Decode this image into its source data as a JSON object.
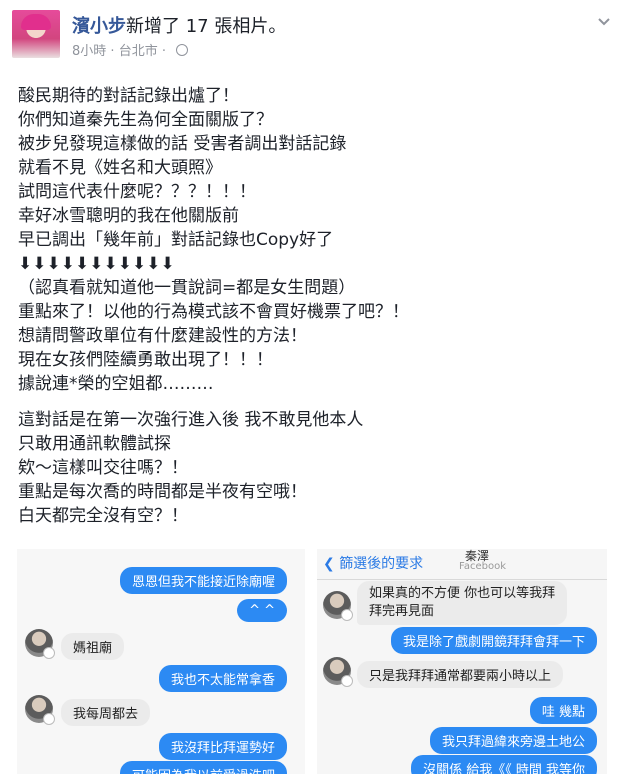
{
  "post": {
    "author": "濱小步",
    "action": "新增了 17 張相片。",
    "time": "8小時",
    "separator": "·",
    "location": "台北市",
    "separator2": "·"
  },
  "body_lines": [
    "酸民期待的對話記錄出爐了！",
    "你們知道秦先生為何全面關版了？",
    "被步兒發現這樣做的話 受害者調出對話記錄",
    "就看不見《姓名和大頭照》",
    "試問這代表什麼呢？？？！！！",
    "幸好冰雪聰明的我在他關版前",
    "早已調出「幾年前」對話記錄也Copy好了",
    "⬇⬇⬇⬇⬇⬇⬇⬇⬇⬇⬇",
    "（認真看就知道他一貫說詞=都是女生問題）",
    "重點來了！以他的行為模式該不會買好機票了吧？！",
    "想請問警政單位有什麼建設性的方法！",
    "現在女孩們陸續勇敢出現了！！！",
    "據說連*榮的空姐都………"
  ],
  "body_lines_2": [
    "這對話是在第一次強行進入後 我不敢見他本人",
    "只敢用通訊軟體試探",
    "欸～這樣叫交往嗎？！",
    "重點是每次喬的時間都是半夜有空哦！",
    "白天都完全沒有空？！"
  ],
  "photo_left": {
    "messages": [
      {
        "dir": "out",
        "text": "恩恩但我不能接近除廟喔"
      },
      {
        "dir": "out",
        "text": "^ ^"
      },
      {
        "dir": "in",
        "text": "媽祖廟"
      },
      {
        "dir": "out",
        "text": "我也不太能常拿香"
      },
      {
        "dir": "in",
        "text": "我每周都去"
      },
      {
        "dir": "out",
        "text": "我沒拜比拜運勢好"
      },
      {
        "dir": "out",
        "text": "可能因為我以前受過洗吧"
      }
    ]
  },
  "photo_right": {
    "back_label": "篩選後的要求",
    "nav_title": "秦澤",
    "nav_subtitle": "Facebook",
    "messages": [
      {
        "dir": "in",
        "text": "如果真的不方便 你也可以等我拜"
      },
      {
        "dir": "in",
        "text": "拜完再見面"
      },
      {
        "dir": "out",
        "text": "我是除了戲劇開鏡拜拜會拜一下"
      },
      {
        "dir": "in",
        "text": "只是我拜拜通常都要兩小時以上"
      },
      {
        "dir": "out",
        "text": "哇 幾點"
      },
      {
        "dir": "out",
        "text": "我只拜過緯來旁邊土地公"
      },
      {
        "dir": "out",
        "text": "沒關係 給我《《 時間 我等你"
      }
    ]
  },
  "colors": {
    "link": "#365899",
    "meta": "#90949c",
    "bubble_out": "#2c8af3",
    "bubble_in": "#ebebeb"
  }
}
